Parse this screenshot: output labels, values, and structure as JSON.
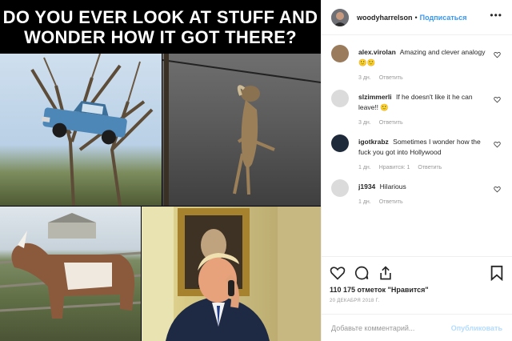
{
  "meme": {
    "line1": "DO YOU EVER LOOK AT STUFF AND",
    "line2": "WONDER HOW IT GOT THERE?"
  },
  "header": {
    "username": "woodyharrelson",
    "separator": "•",
    "follow_label": "Подписаться"
  },
  "comments": [
    {
      "user": "alex.virolan",
      "text": "Amazing and clever analogy🙂🙂",
      "time": "3 дн.",
      "reply": "Ответить",
      "likes": ""
    },
    {
      "user": "slzimmerli",
      "text": "If he doesn't like it he can leave!! 🙂",
      "time": "3 дн.",
      "reply": "Ответить",
      "likes": ""
    },
    {
      "user": "igotkrabz",
      "text": "Sometimes I wonder how the fuck you got into Hollywood",
      "time": "1 дн.",
      "reply": "Ответить",
      "likes": "Нравится: 1"
    },
    {
      "user": "j1934",
      "text": "Hilarious",
      "time": "1 дн.",
      "reply": "Ответить",
      "likes": ""
    }
  ],
  "actions": {
    "likes_text": "110 175 отметок \"Нравится\"",
    "date": "20 ДЕКАБРЯ 2018 Г."
  },
  "add_comment": {
    "placeholder": "Добавьте комментарий...",
    "publish_label": "Опубликовать"
  }
}
